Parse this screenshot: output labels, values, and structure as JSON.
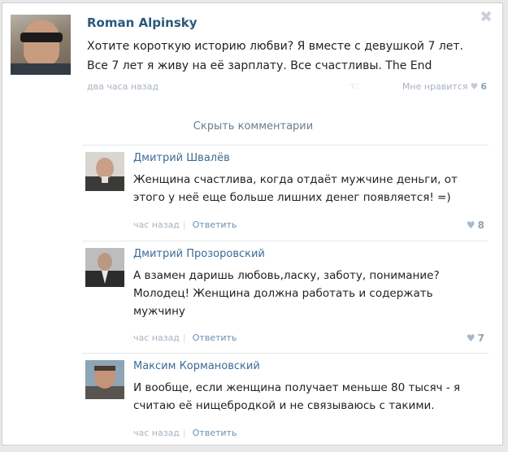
{
  "post": {
    "author": "Roman Alpinsky",
    "text": "Хотите короткую историю любви? Я вместе с девушкой 7 лет. Все 7 лет я живу на её зарплату. Все счастливы. The End",
    "time": "два часа назад",
    "like_label": "Мне нравится",
    "like_count": "6",
    "close_glyph": "✖"
  },
  "hide_comments_label": "Скрыть комментарии",
  "comments": [
    {
      "author": "Дмитрий Швалёв",
      "text": "Женщина счастлива, когда отдаёт мужчине деньги, от этого у неё еще больше лишних денег появляется! =)",
      "time": "час назад",
      "reply_label": "Ответить",
      "like_count": "8"
    },
    {
      "author": "Дмитрий Прозоровский",
      "text": "А взамен даришь любовь,ласку, заботу, понимание? Молодец! Женщина должна работать и содержать мужчину",
      "time": "час назад",
      "reply_label": "Ответить",
      "like_count": "7"
    },
    {
      "author": "Максим Кормановский",
      "text": "И вообще, если женщина получает меньше 80 тысяч - я считаю её нищебродкой и не связываюсь с такими.",
      "time": "час назад",
      "reply_label": "Ответить",
      "like_count": ""
    }
  ],
  "colors": {
    "link": "#2b587a",
    "meta": "#a7b3c0",
    "heart": "#a6b8ca"
  },
  "icons": [
    "close-icon",
    "share-icon",
    "heart-icon"
  ]
}
